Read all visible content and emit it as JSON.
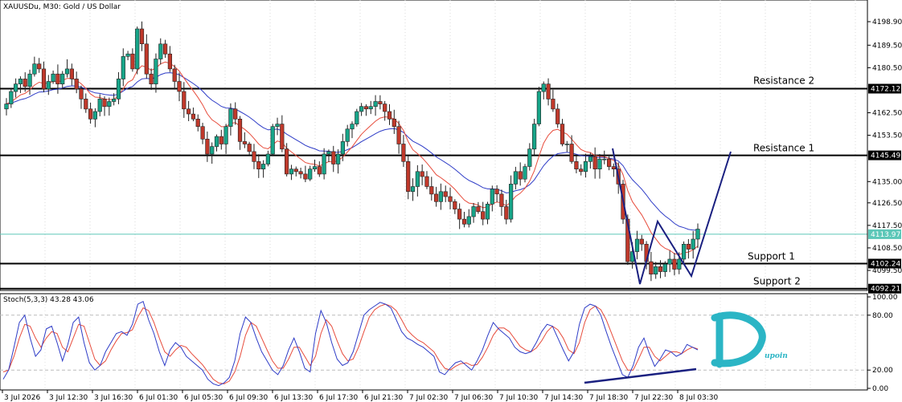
{
  "header": {
    "symbol_text": "XAUUSDu, M30:  Gold / US Dollar"
  },
  "watermark": {
    "text": "Dupoin",
    "color": "#2bb5c5"
  },
  "colors": {
    "bull_candle": "#17a589",
    "bear_candle": "#c0392b",
    "ma_fast": "#e74c3c",
    "ma_slow": "#2e3cc7",
    "stoch_k": "#2e3cc7",
    "stoch_d": "#e74c3c",
    "current_price_line": "#5cc7b8",
    "pattern_line": "#1a2080"
  },
  "chart_data": [
    {
      "type": "candlestick",
      "title": "XAUUSDu, M30:  Gold / US Dollar",
      "ylim": [
        4090,
        4206
      ],
      "y_ticks": [
        "4198.90",
        "4189.50",
        "4180.50",
        "4162.50",
        "4153.50",
        "4135.00",
        "4126.50",
        "4117.50",
        "4108.50",
        "4099.50"
      ],
      "x_ticks": [
        "3 Jul 2026",
        "3 Jul 12:30",
        "3 Jul 16:30",
        "6 Jul 01:30",
        "6 Jul 05:30",
        "6 Jul 09:30",
        "6 Jul 13:30",
        "6 Jul 17:30",
        "6 Jul 21:30",
        "7 Jul 02:30",
        "7 Jul 06:30",
        "7 Jul 10:30",
        "7 Jul 14:30",
        "7 Jul 18:30",
        "7 Jul 22:30",
        "8 Jul 03:30"
      ],
      "current_price": {
        "value": 4113.97,
        "label": "4113.97"
      },
      "levels": [
        {
          "name": "Resistance 2",
          "value": 4172.12,
          "label": "4172.12"
        },
        {
          "name": "Resistance 1",
          "value": 4145.49,
          "label": "4145.49"
        },
        {
          "name": "Support 1",
          "value": 4102.24,
          "label": "4102.24"
        },
        {
          "name": "Support 2",
          "value": 4092.21,
          "label": "4092.21"
        }
      ],
      "close": [
        4166,
        4171,
        4174,
        4176,
        4173,
        4178,
        4182,
        4180,
        4172,
        4175,
        4178,
        4174,
        4178,
        4180,
        4176,
        4172,
        4168,
        4164,
        4160,
        4163,
        4168,
        4165,
        4167,
        4168,
        4176,
        4185,
        4186,
        4180,
        4196,
        4190,
        4178,
        4174,
        4184,
        4190,
        4186,
        4180,
        4175,
        4171,
        4164,
        4162,
        4160,
        4157,
        4152,
        4146,
        4149,
        4153,
        4150,
        4157,
        4164,
        4160,
        4151,
        4150,
        4147,
        4143,
        4140,
        4142,
        4146,
        4157,
        4158,
        4148,
        4138,
        4140,
        4139,
        4138,
        4136,
        4140,
        4141,
        4138,
        4146,
        4147,
        4142,
        4146,
        4151,
        4156,
        4158,
        4163,
        4165,
        4164,
        4165,
        4167,
        4166,
        4163,
        4160,
        4157,
        4150,
        4143,
        4131,
        4133,
        4139,
        4137,
        4133,
        4130,
        4127,
        4131,
        4129,
        4127,
        4124,
        4120,
        4118,
        4121,
        4125,
        4123,
        4120,
        4126,
        4132,
        4130,
        4125,
        4120,
        4134,
        4139,
        4136,
        4141,
        4148,
        4158,
        4171,
        4174,
        4168,
        4164,
        4158,
        4150,
        4150,
        4143,
        4140,
        4139,
        4143,
        4145,
        4140,
        4144,
        4144,
        4141,
        4140,
        4134,
        4120,
        4103,
        4107,
        4112,
        4110,
        4103,
        4098,
        4101,
        4099,
        4102,
        4104,
        4100,
        4104,
        4110,
        4108,
        4112,
        4116
      ],
      "stochastic": {
        "name": "Stoch(5,3,3) 43.28 43.06",
        "k_last": 43.28,
        "d_last": 43.06,
        "ylim": [
          0,
          100
        ],
        "y_ticks": [
          "100.00",
          "80.00",
          "20.00",
          "0.00"
        ],
        "levels": [
          80,
          20
        ],
        "k": [
          10,
          20,
          45,
          72,
          80,
          55,
          35,
          42,
          65,
          68,
          50,
          30,
          48,
          72,
          78,
          50,
          28,
          20,
          25,
          40,
          50,
          60,
          62,
          58,
          70,
          92,
          95,
          75,
          60,
          40,
          25,
          42,
          50,
          45,
          35,
          30,
          25,
          20,
          10,
          5,
          3,
          6,
          12,
          30,
          60,
          78,
          72,
          55,
          40,
          30,
          20,
          15,
          25,
          42,
          55,
          40,
          22,
          18,
          60,
          85,
          72,
          50,
          32,
          25,
          28,
          40,
          60,
          80,
          86,
          90,
          94,
          92,
          88,
          75,
          62,
          55,
          52,
          48,
          45,
          40,
          35,
          18,
          15,
          22,
          28,
          30,
          25,
          20,
          30,
          42,
          58,
          72,
          65,
          60,
          55,
          45,
          40,
          38,
          40,
          50,
          62,
          70,
          68,
          55,
          42,
          30,
          40,
          70,
          88,
          92,
          90,
          80,
          62,
          45,
          30,
          15,
          12,
          25,
          45,
          55,
          38,
          24,
          32,
          42,
          40,
          35,
          38,
          48,
          45,
          42
        ],
        "d": [
          18,
          20,
          35,
          55,
          70,
          68,
          55,
          45,
          55,
          62,
          60,
          45,
          40,
          55,
          70,
          68,
          50,
          32,
          25,
          30,
          42,
          52,
          60,
          61,
          64,
          78,
          88,
          85,
          72,
          55,
          40,
          35,
          42,
          47,
          45,
          38,
          32,
          26,
          18,
          10,
          6,
          5,
          8,
          18,
          35,
          58,
          72,
          68,
          55,
          42,
          30,
          22,
          22,
          32,
          45,
          45,
          35,
          25,
          35,
          60,
          75,
          68,
          52,
          38,
          30,
          32,
          45,
          62,
          78,
          86,
          90,
          92,
          90,
          85,
          75,
          64,
          58,
          53,
          50,
          45,
          40,
          30,
          22,
          20,
          24,
          27,
          28,
          25,
          26,
          34,
          45,
          58,
          66,
          66,
          62,
          54,
          46,
          42,
          40,
          44,
          52,
          62,
          68,
          64,
          55,
          42,
          38,
          50,
          72,
          86,
          90,
          86,
          75,
          60,
          45,
          30,
          20,
          20,
          32,
          45,
          45,
          35,
          30,
          35,
          40,
          40,
          38,
          42,
          45,
          43
        ]
      }
    }
  ],
  "labels": {
    "resistance2": "Resistance 2",
    "resistance1": "Resistance 1",
    "support1": "Support 1",
    "support2": "Support 2"
  }
}
